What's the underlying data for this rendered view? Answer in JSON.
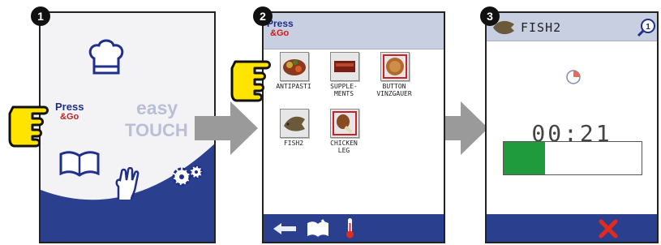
{
  "steps": [
    "1",
    "2",
    "3"
  ],
  "panel1": {
    "press": "Press",
    "go": "&Go",
    "easy": "easy",
    "touch": "TOUCH"
  },
  "panel2": {
    "press": "Press",
    "go": "&Go",
    "tiles": [
      {
        "label1": "ANTIPASTI",
        "label2": ""
      },
      {
        "label1": "SUPPLE-",
        "label2": "MENTS"
      },
      {
        "label1": "BUTTON",
        "label2": "VINZGAUER"
      },
      {
        "label1": "FISH2",
        "label2": ""
      },
      {
        "label1": "CHICKEN",
        "label2": "LEG"
      }
    ]
  },
  "panel3": {
    "title": "FISH2",
    "zoom_badge": "1",
    "timer": "00:21",
    "progress": 0.3
  },
  "colors": {
    "accent": "#2b3f8f",
    "header": "#c8cfe0",
    "progress": "#1f9a3c",
    "cancel": "#e32b1c"
  }
}
